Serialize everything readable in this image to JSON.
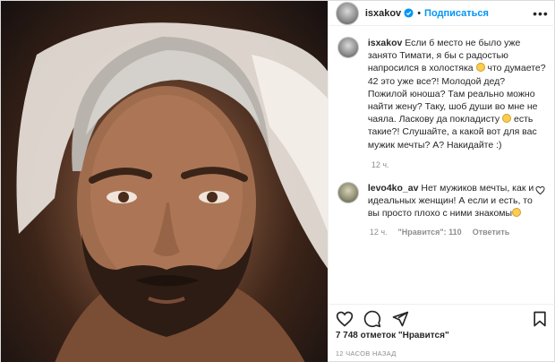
{
  "header": {
    "username": "isxakov",
    "separator": "•",
    "follow_label": "Подписаться",
    "more_label": "•••"
  },
  "caption": {
    "username": "isxakov",
    "parts": [
      " Если б место не было уже занято Тимати, я бы с радостью напросился в холостяка ",
      " что думаете? 42 это уже все?! Молодой дед? Пожилой юноша? Там реально можно найти жену? Таку, шоб души во мне не чаяла. Ласкову да покладисту ",
      " есть такие?! Слушайте, а какой вот для вас мужик мечты? А? Накидайте :)"
    ],
    "time": "12 ч."
  },
  "comment": {
    "username": "levo4ko_av",
    "text": " Нет мужиков мечты, как и идеальных женщин! А если и есть, то вы просто плохо с ними знакомы",
    "time": "12 ч.",
    "likes": "\"Нравится\": 110",
    "reply_label": "Ответить"
  },
  "likes_text": "7 748 отметок \"Нравится\"",
  "posted_time": "12 ЧАСОВ НАЗАД",
  "icons": {
    "verified": "verified-badge-icon",
    "heart": "heart-icon",
    "comment": "comment-icon",
    "share": "share-icon",
    "save": "bookmark-icon"
  },
  "colors": {
    "accent": "#0095f6",
    "muted": "#8e8e8e",
    "text": "#262626"
  }
}
